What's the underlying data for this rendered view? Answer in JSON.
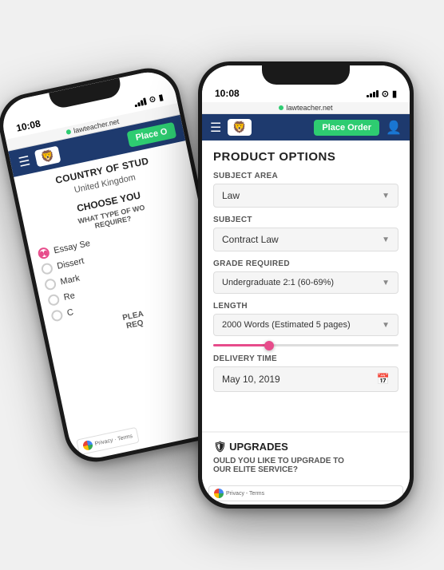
{
  "scene": {
    "background": "#f0f0f0"
  },
  "back_phone": {
    "status_bar": {
      "time": "10:08",
      "url": "lawteacher.net"
    },
    "navbar": {
      "place_order": "Place O"
    },
    "country_section": {
      "title": "COUNTRY OF STUD",
      "value": "United Kingdom"
    },
    "choose_section": {
      "title": "CHOOSE YOU",
      "subtitle": "WHAT TYPE OF WO",
      "subtitle2": "REQUIRE?"
    },
    "radio_options": [
      {
        "label": "Essay Se",
        "active": true
      },
      {
        "label": "Dissert",
        "active": false
      },
      {
        "label": "Mark",
        "active": false
      },
      {
        "label": "Re",
        "active": false
      },
      {
        "label": "C",
        "active": false
      }
    ],
    "please_label": "PLEA",
    "please_label2": "REQ"
  },
  "front_phone": {
    "status_bar": {
      "time": "10:08",
      "url": "lawteacher.net"
    },
    "navbar": {
      "place_order_label": "Place Order",
      "logo_text": "🦁"
    },
    "page_title": "PRODUCT OPTIONS",
    "subject_area": {
      "label": "SUBJECT AREA",
      "value": "Law"
    },
    "subject": {
      "label": "SUBJECT",
      "value": "Contract Law"
    },
    "grade_required": {
      "label": "GRADE REQUIRED",
      "value": "Undergraduate 2:1 (60-69%)"
    },
    "length": {
      "label": "LENGTH",
      "value": "2000 Words (Estimated 5 pages)"
    },
    "delivery_time": {
      "label": "DELIVERY TIME",
      "value": "May 10, 2019"
    },
    "upgrades": {
      "title": "UPGRADES",
      "subtitle": "OULD YOU LIKE TO UPGRADE TO",
      "subtitle2": "OUR ELITE SERVICE?"
    },
    "recaptcha": "Privacy - Terms"
  }
}
